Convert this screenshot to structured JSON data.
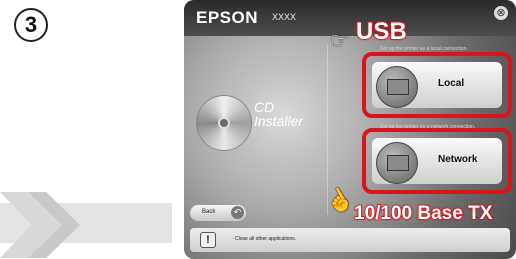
{
  "step": {
    "number": "3"
  },
  "window": {
    "brand": "EPSON",
    "model": "XXXX",
    "close_glyph": "⊗",
    "cd_title_line1": "CD",
    "cd_title_line2": "Installer",
    "local_hint": "Set up the printer as a local connection.",
    "network_hint": "Set up the printer on a network connection.",
    "local_label": "Local",
    "network_label": "Network",
    "back_label": "Back",
    "back_icon": "back-arrow-icon",
    "message_text": "· Close all other applications."
  },
  "callouts": {
    "usb": "USB",
    "network": "10/100 Base TX"
  },
  "colors": {
    "highlight": "#d8151a"
  }
}
